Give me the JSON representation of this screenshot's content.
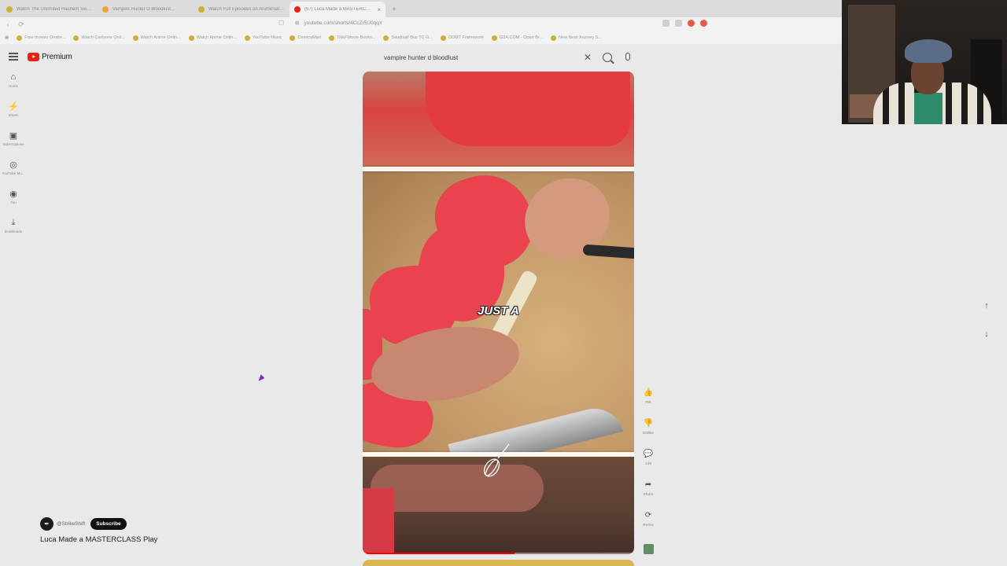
{
  "browser": {
    "tabs": [
      {
        "title": "Watch The Unlimited Hashem Swal...",
        "fav_color": "#c9b23a",
        "active": false
      },
      {
        "title": "Vampire Hunter D Bloodlust...",
        "fav_color": "#e9a53a",
        "active": false
      },
      {
        "title": "Watch Full Episodes on AnimeSaturn",
        "fav_color": "#c9b23a",
        "active": false
      },
      {
        "title": "(67) Luca Made a MASTERCLASS",
        "fav_color": "#e62117",
        "active": true
      }
    ],
    "new_tab_label": "+",
    "url": "youtube.com/shorts/4CcZr5U0qqY",
    "bookmarks": [
      "Free movies Onsite...",
      "Watch Cartoons Onli...",
      "Watch Anime Onlin...",
      "Watch Anime Onlin...",
      "YouTube Music",
      "ComicaMart",
      "TikkFMovie Books...",
      "Saudisall Bus TC G...",
      "ODMT Framework",
      "G2A.COM - Open Br...",
      "New Nest Journey S..."
    ]
  },
  "header": {
    "logo_text": "Premium",
    "search_value": "vampire hunter d bloodlust",
    "clear_icon": "close-icon",
    "search_icon": "search-icon",
    "mic_icon": "mic-icon"
  },
  "rail": {
    "items": [
      {
        "label": "Home",
        "icon": "⌂"
      },
      {
        "label": "Shorts",
        "icon": "⚡"
      },
      {
        "label": "Subscriptions",
        "icon": "▣"
      },
      {
        "label": "YouTube Mu...",
        "icon": "◎"
      },
      {
        "label": "You",
        "icon": "◉"
      },
      {
        "label": "Downloads",
        "icon": "⤓"
      }
    ]
  },
  "video": {
    "caption": "JUST A",
    "progress": 0.56
  },
  "actions": [
    {
      "name": "like",
      "icon": "👍",
      "label": "76K"
    },
    {
      "name": "dislike",
      "icon": "👎",
      "label": "Dislike"
    },
    {
      "name": "comments",
      "icon": "💬",
      "label": "146"
    },
    {
      "name": "share",
      "icon": "➦",
      "label": "Share"
    },
    {
      "name": "remix",
      "icon": "⟳",
      "label": "Remix"
    }
  ],
  "channel": {
    "handle": "@StrikeShift",
    "subscribe_label": "Subscribe"
  },
  "video_title": "Luca Made a MASTERCLASS Play",
  "nav": {
    "up": "↑",
    "down": "↓"
  }
}
